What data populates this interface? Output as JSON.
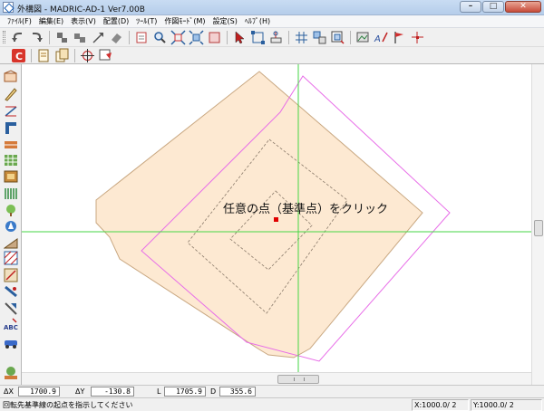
{
  "window": {
    "title": "外構図 - MADRIC-AD-1 Ver7.00B",
    "buttons": {
      "minimize": "–",
      "maximize": "□",
      "close": "✕"
    }
  },
  "menu": [
    {
      "label": "ﾌｧｲﾙ(F)",
      "name": "menu-file"
    },
    {
      "label": "編集(E)",
      "name": "menu-edit"
    },
    {
      "label": "表示(V)",
      "name": "menu-view"
    },
    {
      "label": "配置(D)",
      "name": "menu-place"
    },
    {
      "label": "ﾂｰﾙ(T)",
      "name": "menu-tool"
    },
    {
      "label": "作図ﾓｰﾄﾞ(M)",
      "name": "menu-draw-mode"
    },
    {
      "label": "設定(S)",
      "name": "menu-settings"
    },
    {
      "label": "ﾍﾙﾌﾟ(H)",
      "name": "menu-help"
    }
  ],
  "canvas": {
    "prompt": "任意の点（基準点）をクリック"
  },
  "coords": {
    "dx_label": "ΔX",
    "dx_value": "1700.9",
    "dy_label": "ΔY",
    "dy_value": "-130.8",
    "l_label": "L",
    "l_value": "1705.9",
    "d_label": "D",
    "d_value": "355.6"
  },
  "status": {
    "message": "回転先基準線の起点を指示してください",
    "x_scale": "X:1000.0/ 2",
    "y_scale": "Y:1000.0/ 2"
  },
  "colors": {
    "shape_fill": "#fde9d2",
    "shape_stroke": "#c9a882",
    "magenta": "#e86ee8",
    "crosshair": "#46d646",
    "basepoint": "#e00000"
  }
}
